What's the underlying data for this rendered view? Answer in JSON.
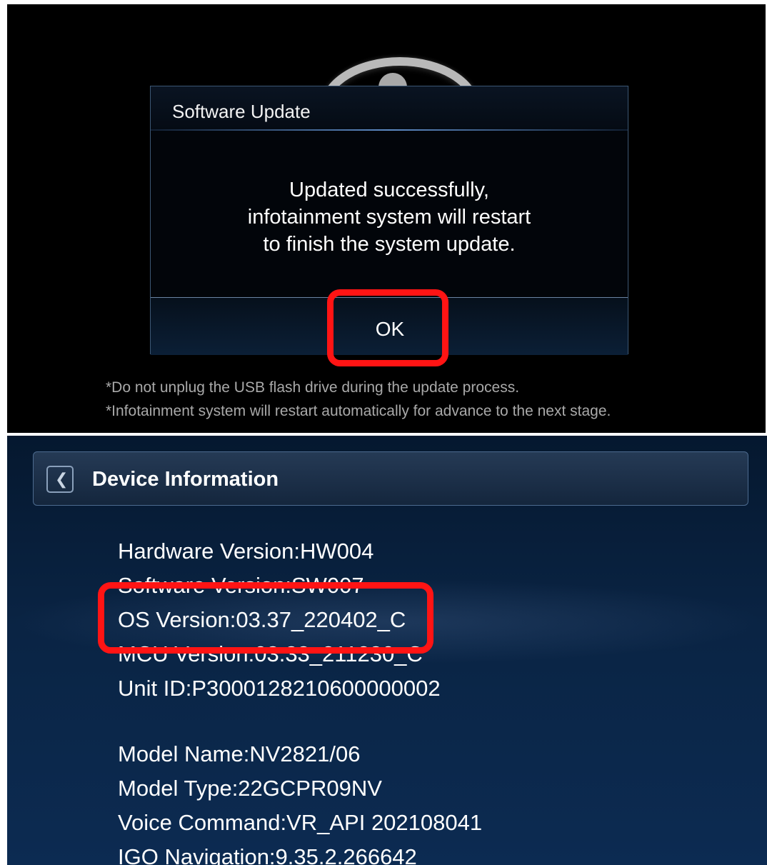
{
  "software_update_dialog": {
    "title": "Software Update",
    "message_lines": [
      "Updated successfully,",
      "infotainment system will restart",
      "to finish the system update."
    ],
    "ok_button": "OK"
  },
  "footnotes": [
    "*Do not unplug the USB flash drive during the update process.",
    "*Infotainment system will restart automatically for advance to the next stage."
  ],
  "device_information": {
    "title": "Device Information",
    "back_icon": "chevron-left-icon",
    "items": [
      "Hardware Version:HW004",
      "Software Version:SW007",
      "OS Version:03.37_220402_C",
      "MCU Version:03.33_211230_C",
      "Unit ID:P3000128210600000002"
    ],
    "items_group2": [
      "Model Name:NV2821/06",
      "Model Type:22GCPR09NV",
      "Voice Command:VR_API 202108041",
      "IGO Navigation:9.35.2.266642"
    ]
  },
  "colors": {
    "highlight": "#ff1414",
    "dialog_border": "#3c5774",
    "panel_bg": "#0a2444"
  }
}
